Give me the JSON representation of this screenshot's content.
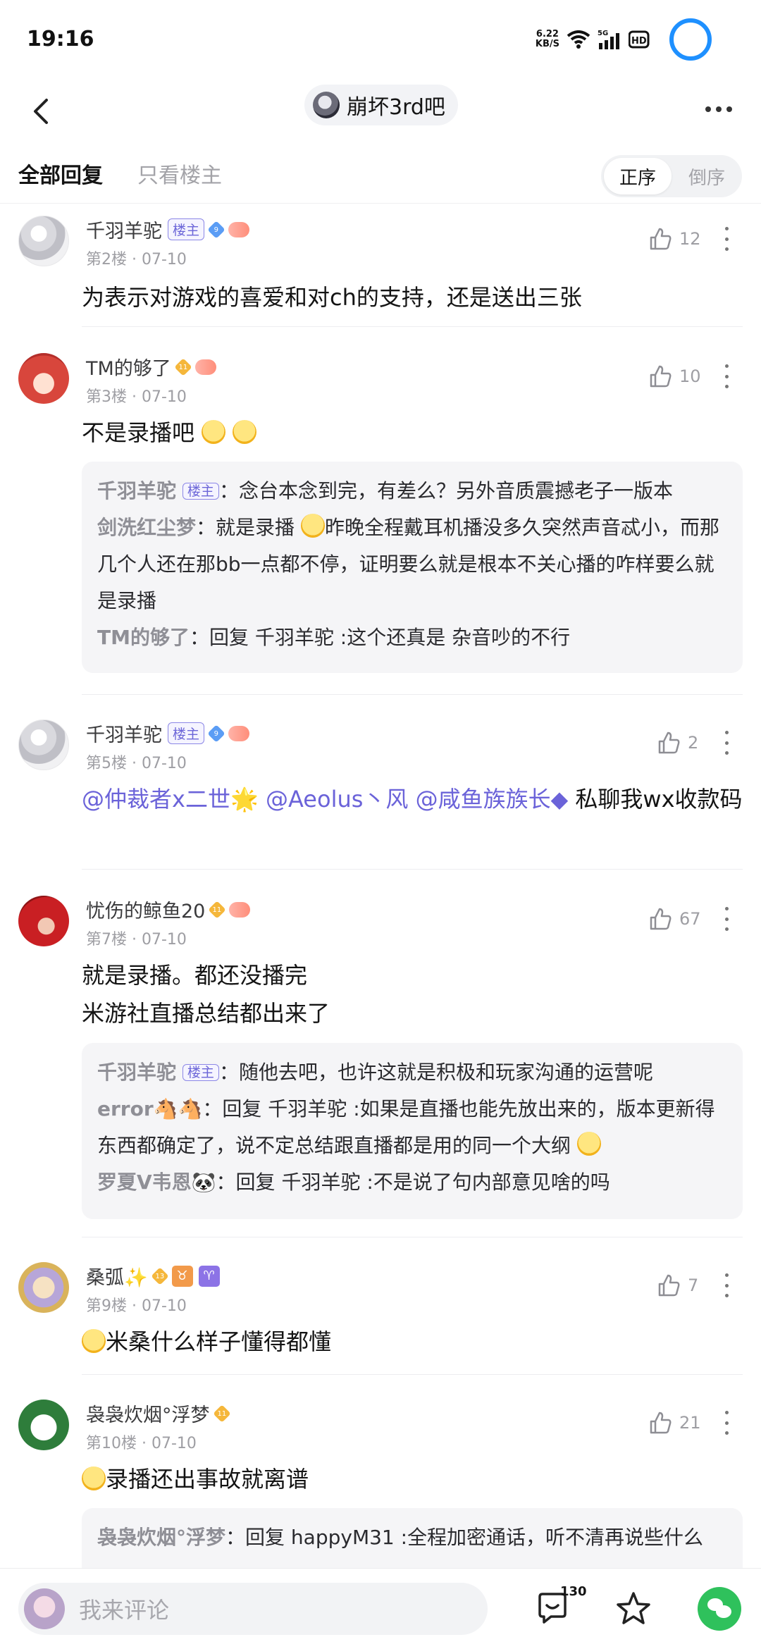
{
  "status": {
    "time": "19:16",
    "speed": "6.22",
    "speed_unit": "KB/S",
    "net": "5G",
    "hd": "HD"
  },
  "nav": {
    "forum_name": "崩坏3rd吧"
  },
  "filters": {
    "all": "全部回复",
    "op_only": "只看楼主",
    "asc": "正序",
    "desc": "倒序"
  },
  "posts": [
    {
      "name": "千羽羊驼",
      "op_badge": "楼主",
      "level": "9",
      "floor": "第2楼 · 07-10",
      "likes": "12",
      "content": "为表示对游戏的喜爱和对ch的支持，还是送出三张"
    },
    {
      "name": "TM的够了",
      "level": "11",
      "floor": "第3楼 · 07-10",
      "likes": "10",
      "content": "不是录播吧",
      "replies": [
        {
          "name": "千羽羊驼",
          "op_badge": "楼主",
          "text": "：念台本念到完，有差么？另外音质震撼老子一版本"
        },
        {
          "name": "剑洗红尘梦",
          "text": "：就是录播",
          "text2": "昨晚全程戴耳机播没多久突然声音忒小，而那几个人还在那bb一点都不停，证明要么就是根本不关心播的咋样要么就是录播"
        },
        {
          "name": "TM的够了",
          "text": "：回复 千羽羊驼 :这个还真是 杂音吵的不行"
        }
      ]
    },
    {
      "name": "千羽羊驼",
      "op_badge": "楼主",
      "level": "9",
      "floor": "第5楼 · 07-10",
      "likes": "2",
      "mentions": [
        "@仲裁者x二世🌟",
        "@Aeolus丶风",
        "@咸鱼族族长◆"
      ],
      "content": "私聊我wx收款码"
    },
    {
      "name": "忧伤的鲸鱼20",
      "level": "11",
      "floor": "第7楼 · 07-10",
      "likes": "67",
      "content_lines": [
        "就是录播。都还没播完",
        "米游社直播总结都出来了"
      ],
      "replies": [
        {
          "name": "千羽羊驼",
          "op_badge": "楼主",
          "text": "：随他去吧，也许这就是积极和玩家沟通的运营呢"
        },
        {
          "name": "error🐴🐴",
          "text": "：回复 千羽羊驼 :如果是直播也能先放出来的，版本更新得东西都确定了，说不定总结跟直播都是用的同一个大纲"
        },
        {
          "name": "罗夏V韦恩🐼",
          "text": "：回复 千羽羊驼 :不是说了句内部意见啥的吗"
        }
      ]
    },
    {
      "name": "桑弧✨",
      "level": "13",
      "floor": "第9楼 · 07-10",
      "likes": "7",
      "zodiac": [
        "♉",
        "♈"
      ],
      "content": "米桑什么样子懂得都懂"
    },
    {
      "name": "袅袅炊烟°浮梦",
      "level": "11",
      "floor": "第10楼 · 07-10",
      "likes": "21",
      "content": "录播还出事故就离谱",
      "replies": [
        {
          "name": "袅袅炊烟°浮梦",
          "text": "：回复 happyM31 :全程加密通话，听不清再说些什么"
        }
      ]
    }
  ],
  "bottom": {
    "placeholder": "我来评论",
    "comment_count": "130"
  },
  "colors": {
    "accent": "#6b63d9",
    "ring": "#1e90ff",
    "wechat": "#2fc15c"
  }
}
